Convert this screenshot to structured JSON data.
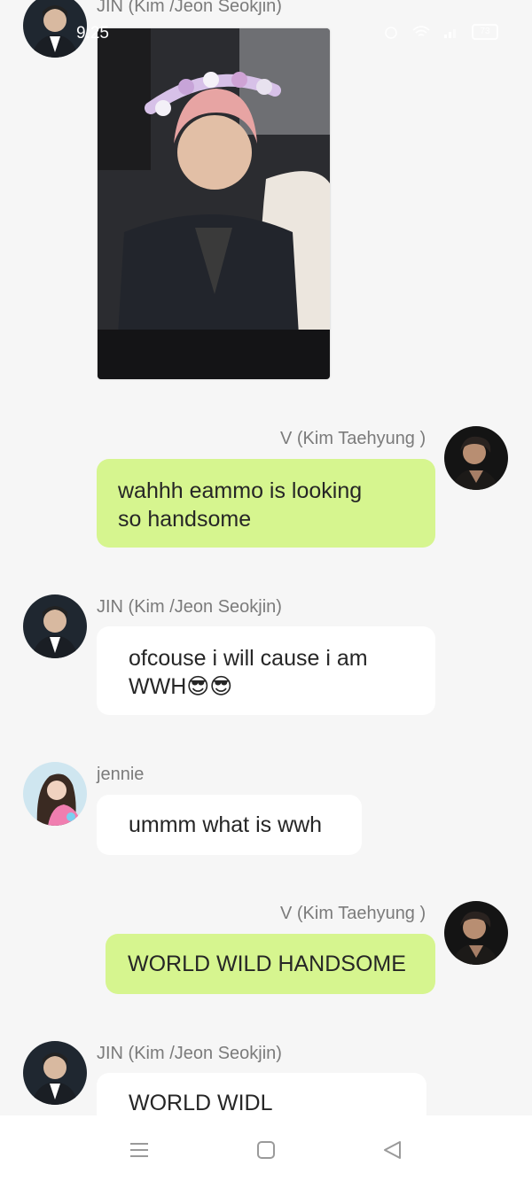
{
  "status": {
    "time": "9:25",
    "battery": "73"
  },
  "messages": [
    {
      "sender": "JIN (Kim /Jeon Seokjin)",
      "type": "image",
      "side": "left"
    },
    {
      "sender": "V (Kim Taehyung )",
      "text_line1": "wahhh eammo is looking",
      "text_line2": "so handsome",
      "side": "right"
    },
    {
      "sender": "JIN (Kim /Jeon Seokjin)",
      "text_line1": "ofcouse i will cause i am",
      "text_line2": "WWH😎😎",
      "side": "left"
    },
    {
      "sender": "jennie",
      "text": "ummm what is wwh",
      "side": "left"
    },
    {
      "sender": "V (Kim Taehyung )",
      "text": "WORLD WILD HANDSOME",
      "side": "right"
    },
    {
      "sender": "JIN (Kim /Jeon Seokjin)",
      "text": "WORLD WIDL HANDSOME",
      "side": "left"
    }
  ],
  "navbar": {
    "icons": [
      "menu-icon",
      "home-icon",
      "back-icon"
    ]
  },
  "colors": {
    "background": "#f6f6f6",
    "bubble_self": "#d6f58f",
    "bubble_other": "#ffffff",
    "sender_text": "#7b7b7b"
  }
}
